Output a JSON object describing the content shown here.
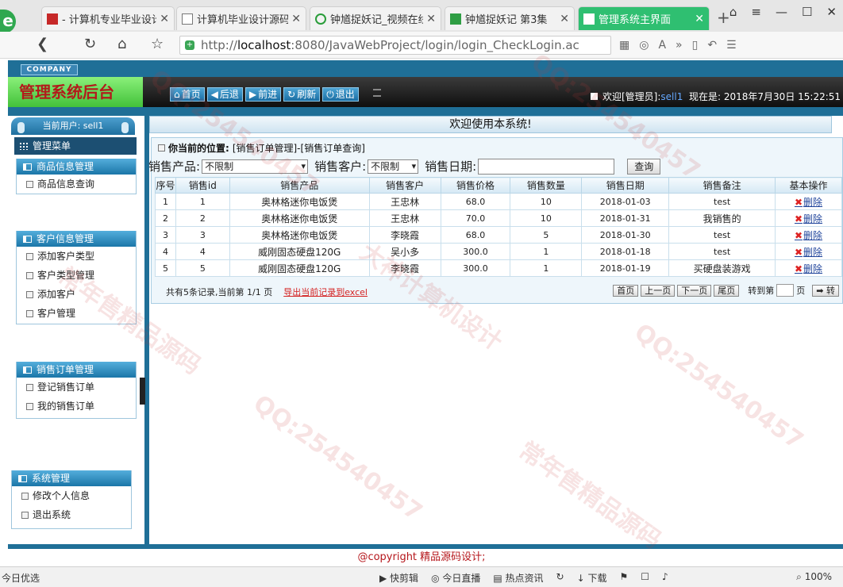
{
  "browser": {
    "tabs": [
      {
        "label": "- 计算机专业毕业设计",
        "active": false
      },
      {
        "label": "计算机毕业设计源码",
        "active": false
      },
      {
        "label": "钟馗捉妖记_视频在线",
        "active": false
      },
      {
        "label": "钟馗捉妖记 第3集",
        "active": false
      },
      {
        "label": "管理系统主界面",
        "active": true
      }
    ],
    "url_host": "localhost",
    "url_rest": ":8080/JavaWebProject/login/login_CheckLogin.ac",
    "url_scheme": "http://"
  },
  "app": {
    "company": "COMPANY",
    "title": "管理系统后台",
    "header_buttons": [
      "首页",
      "后退",
      "前进",
      "刷新",
      "退出"
    ],
    "welcome_prefix": "欢迎[管理员]:",
    "username": "sell1",
    "now_label": "现在是:",
    "now_value": "2018年7月30日 15:22:51"
  },
  "sidebar": {
    "current_user": "当前用户: sell1",
    "menu_title": "管理菜单",
    "groups": [
      {
        "title": "商品信息管理",
        "items": [
          "商品信息查询"
        ]
      },
      {
        "title": "客户信息管理",
        "items": [
          "添加客户类型",
          "客户类型管理",
          "添加客户",
          "客户管理"
        ]
      },
      {
        "title": "销售订单管理",
        "items": [
          "登记销售订单",
          "我的销售订单"
        ]
      },
      {
        "title": "系统管理",
        "items": [
          "修改个人信息",
          "退出系统"
        ]
      }
    ]
  },
  "main": {
    "welcome": "欢迎使用本系统!",
    "breadcrumb_label": "你当前的位置:",
    "breadcrumb_value": "[销售订单管理]-[销售订单查询]",
    "filters": {
      "product_label": "销售产品:",
      "product_value": "不限制",
      "customer_label": "销售客户:",
      "customer_value": "不限制",
      "date_label": "销售日期:",
      "date_value": "",
      "query_button": "查询"
    },
    "table": {
      "columns": [
        "序号",
        "销售id",
        "销售产品",
        "销售客户",
        "销售价格",
        "销售数量",
        "销售日期",
        "销售备注",
        "基本操作"
      ],
      "delete_label": "删除",
      "rows": [
        [
          "1",
          "1",
          "奥林格迷你电饭煲",
          "王忠林",
          "68.0",
          "10",
          "2018-01-03",
          "test"
        ],
        [
          "2",
          "2",
          "奥林格迷你电饭煲",
          "王忠林",
          "70.0",
          "10",
          "2018-01-31",
          "我销售的"
        ],
        [
          "3",
          "3",
          "奥林格迷你电饭煲",
          "李晓霞",
          "68.0",
          "5",
          "2018-01-30",
          "test"
        ],
        [
          "4",
          "4",
          "威刚固态硬盘120G",
          "吴小多",
          "300.0",
          "1",
          "2018-01-18",
          "test"
        ],
        [
          "5",
          "5",
          "威刚固态硬盘120G",
          "李晓霞",
          "300.0",
          "1",
          "2018-01-19",
          "买硬盘装游戏"
        ]
      ]
    },
    "pager": {
      "summary": "共有5条记录,当前第 1/1 页",
      "export": "导出当前记录到excel",
      "first": "首页",
      "prev": "上一页",
      "next": "下一页",
      "last": "尾页",
      "goto_label": "转到第",
      "page_suffix": "页",
      "go_button": "转"
    }
  },
  "footer": {
    "copyright": "@copyright 精品源码设计;"
  },
  "statusbar": {
    "left": "今日优选",
    "items": [
      "快剪辑",
      "今日直播",
      "热点资讯",
      "下载"
    ],
    "zoom": "100%"
  },
  "watermarks": [
    "QQ:254540457",
    "大神计算机设计",
    "常年售精品源码"
  ],
  "colors": {
    "app_frame": "#1f6f97",
    "title_green": "#43c13a",
    "title_text": "#b21b1b",
    "footer_red": "#b5161b",
    "export_red": "#d42222"
  }
}
